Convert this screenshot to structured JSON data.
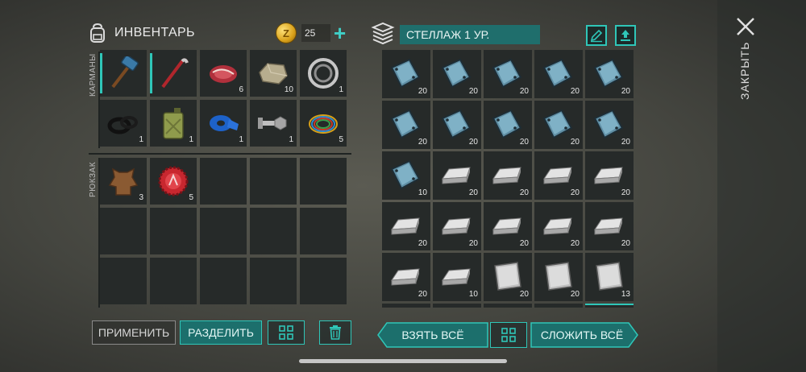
{
  "inventory": {
    "title": "ИНВЕНТАРЬ",
    "coins": "25",
    "coin_symbol": "Z",
    "pockets_label": "КАРМАНЫ",
    "backpack_label": "РЮКЗАК",
    "pockets": [
      {
        "icon": "hammer-icon",
        "count": "",
        "selected": true
      },
      {
        "icon": "crowbar-icon",
        "count": "",
        "selected": true
      },
      {
        "icon": "meat-icon",
        "count": "6"
      },
      {
        "icon": "stone-icon",
        "count": "10"
      },
      {
        "icon": "bearing-icon",
        "count": "1"
      },
      {
        "icon": "rubber-rings-icon",
        "count": "1"
      },
      {
        "icon": "jerrycan-icon",
        "count": "1"
      },
      {
        "icon": "tape-icon",
        "count": "1"
      },
      {
        "icon": "bolt-nut-icon",
        "count": "1"
      },
      {
        "icon": "wires-icon",
        "count": "5"
      }
    ],
    "backpack": [
      {
        "icon": "leather-icon",
        "count": "3"
      },
      {
        "icon": "bottle-cap-icon",
        "count": "5"
      },
      {
        "icon": "",
        "count": ""
      },
      {
        "icon": "",
        "count": ""
      },
      {
        "icon": "",
        "count": ""
      },
      {
        "icon": "",
        "count": ""
      },
      {
        "icon": "",
        "count": ""
      },
      {
        "icon": "",
        "count": ""
      },
      {
        "icon": "",
        "count": ""
      },
      {
        "icon": "",
        "count": ""
      },
      {
        "icon": "",
        "count": ""
      },
      {
        "icon": "",
        "count": ""
      },
      {
        "icon": "",
        "count": ""
      },
      {
        "icon": "",
        "count": ""
      },
      {
        "icon": "",
        "count": ""
      }
    ],
    "buttons": {
      "apply": "ПРИМЕНИТЬ",
      "split": "РАЗДЕЛИТЬ"
    }
  },
  "shelf": {
    "title": "СТЕЛЛАЖ 1 УР.",
    "items": [
      {
        "icon": "glass-plate-icon",
        "count": "20"
      },
      {
        "icon": "glass-plate-icon",
        "count": "20"
      },
      {
        "icon": "glass-plate-icon",
        "count": "20"
      },
      {
        "icon": "glass-plate-icon",
        "count": "20"
      },
      {
        "icon": "glass-plate-icon",
        "count": "20"
      },
      {
        "icon": "glass-plate-icon",
        "count": "20"
      },
      {
        "icon": "glass-plate-icon",
        "count": "20"
      },
      {
        "icon": "glass-plate-icon",
        "count": "20"
      },
      {
        "icon": "glass-plate-icon",
        "count": "20"
      },
      {
        "icon": "glass-plate-icon",
        "count": "20"
      },
      {
        "icon": "glass-plate-icon",
        "count": "10"
      },
      {
        "icon": "silver-ingot-icon",
        "count": "20"
      },
      {
        "icon": "silver-ingot-icon",
        "count": "20"
      },
      {
        "icon": "silver-ingot-icon",
        "count": "20"
      },
      {
        "icon": "silver-ingot-icon",
        "count": "20"
      },
      {
        "icon": "silver-ingot-icon",
        "count": "20"
      },
      {
        "icon": "silver-ingot-icon",
        "count": "20"
      },
      {
        "icon": "silver-ingot-icon",
        "count": "20"
      },
      {
        "icon": "silver-ingot-icon",
        "count": "20"
      },
      {
        "icon": "silver-ingot-icon",
        "count": "20"
      },
      {
        "icon": "silver-ingot-icon",
        "count": "20"
      },
      {
        "icon": "silver-ingot-icon",
        "count": "10"
      },
      {
        "icon": "steel-sheet-icon",
        "count": "20"
      },
      {
        "icon": "steel-sheet-icon",
        "count": "20"
      },
      {
        "icon": "steel-sheet-icon",
        "count": "13"
      }
    ],
    "buttons": {
      "take_all": "ВЗЯТЬ ВСЁ",
      "put_all": "СЛОЖИТЬ ВСЁ"
    }
  },
  "close_label": "ЗАКРЫТЬ",
  "colors": {
    "accent": "#2fc6b8",
    "teal_bg": "#1c6f6c",
    "cell": "#262a29"
  }
}
